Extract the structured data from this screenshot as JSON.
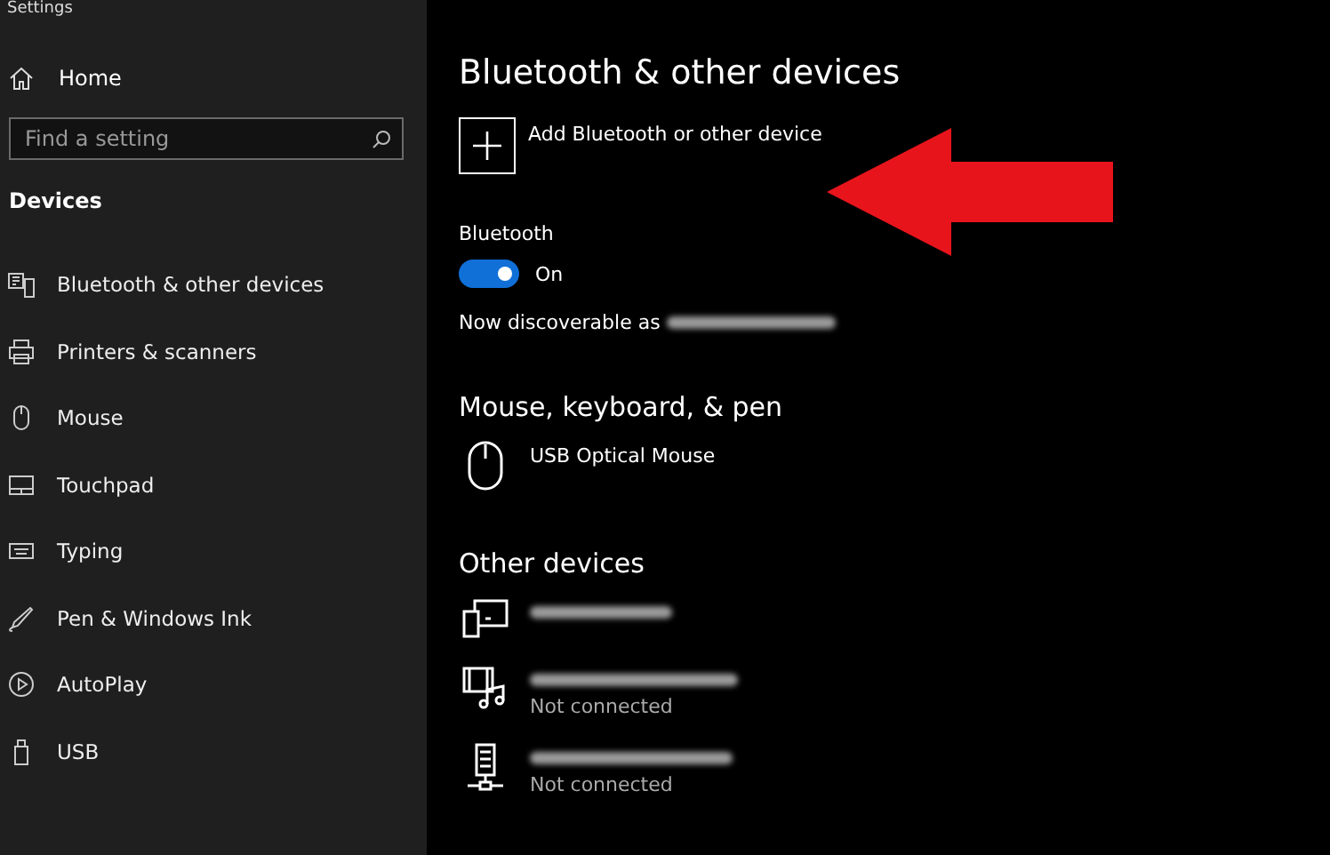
{
  "window": {
    "title": "Settings"
  },
  "sidebar": {
    "home": "Home",
    "search": {
      "placeholder": "Find a setting"
    },
    "section": "Devices",
    "items": [
      {
        "label": "Bluetooth & other devices",
        "kind": "bluetooth"
      },
      {
        "label": "Printers & scanners",
        "kind": "printer"
      },
      {
        "label": "Mouse",
        "kind": "mouse"
      },
      {
        "label": "Touchpad",
        "kind": "touchpad"
      },
      {
        "label": "Typing",
        "kind": "keyboard"
      },
      {
        "label": "Pen & Windows Ink",
        "kind": "pen"
      },
      {
        "label": "AutoPlay",
        "kind": "autoplay"
      },
      {
        "label": "USB",
        "kind": "usb"
      }
    ]
  },
  "main": {
    "title": "Bluetooth & other devices",
    "add_button": "Add Bluetooth or other device",
    "bluetooth": {
      "label": "Bluetooth",
      "on": true,
      "state_text": "On",
      "discoverable": "Now discoverable as"
    },
    "sections": [
      {
        "heading": "Mouse, keyboard, & pen",
        "devices": [
          {
            "kind": "mouse",
            "name": "USB Optical Mouse"
          }
        ]
      },
      {
        "heading": "Other devices",
        "devices": [
          {
            "kind": "display",
            "name_redacted": true
          },
          {
            "kind": "media",
            "name_redacted": true,
            "status": "Not connected"
          },
          {
            "kind": "network",
            "name_redacted": true,
            "status": "Not connected"
          }
        ]
      }
    ]
  },
  "annotation": {
    "kind": "arrow",
    "color": "#e8141c"
  }
}
